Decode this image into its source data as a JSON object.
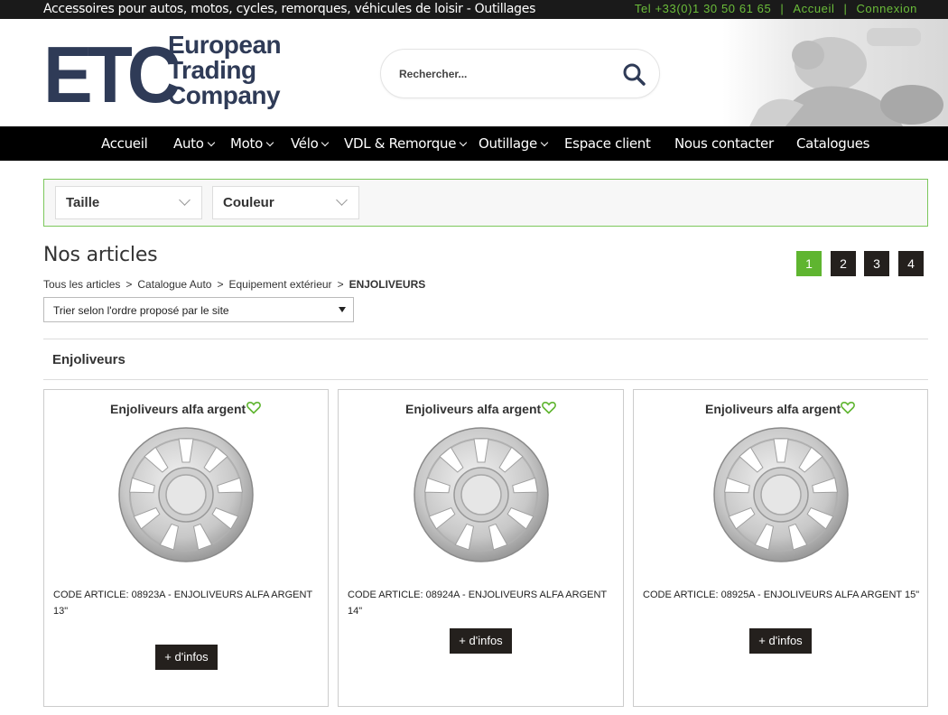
{
  "topbar": {
    "tagline": "Accessoires pour autos, motos, cycles, remorques, véhicules de loisir - Outillages",
    "phone": "Tel +33(0)1 30 50 61 65",
    "separator": "|",
    "home_link": "Accueil",
    "login_link": "Connexion"
  },
  "header": {
    "logo_letters": "ETC",
    "logo_words": [
      "European",
      "Trading",
      "Company"
    ],
    "search_placeholder": "Rechercher...",
    "search_icon": "search-icon"
  },
  "nav": {
    "items": [
      {
        "label": "Accueil",
        "dropdown": false
      },
      {
        "label": "Auto",
        "dropdown": true
      },
      {
        "label": "Moto",
        "dropdown": true
      },
      {
        "label": "Vélo",
        "dropdown": true
      },
      {
        "label": "VDL & Remorque",
        "dropdown": true
      },
      {
        "label": "Outillage",
        "dropdown": true
      },
      {
        "label": "Espace client",
        "dropdown": false
      },
      {
        "label": "Nous contacter",
        "dropdown": false
      },
      {
        "label": "Catalogues",
        "dropdown": false
      }
    ]
  },
  "filters": {
    "size_label": "Taille",
    "color_label": "Couleur"
  },
  "main": {
    "title": "Nos articles",
    "pages": [
      "1",
      "2",
      "3",
      "4"
    ],
    "current_page": "1",
    "breadcrumb": {
      "items": [
        "Tous les articles",
        "Catalogue Auto",
        "Equipement extérieur"
      ],
      "current": "ENJOLIVEURS",
      "separator": ">"
    },
    "sort_label": "Trier selon l'ordre proposé par le site",
    "section_title": "Enjoliveurs"
  },
  "products": [
    {
      "name": "Enjoliveurs alfa argent",
      "code_line1": "CODE ARTICLE: 08923A - ENJOLIVEURS ALFA ARGENT",
      "code_line2": "13\"",
      "button": "+ d'infos"
    },
    {
      "name": "Enjoliveurs alfa argent",
      "code_line1": "CODE ARTICLE: 08924A - ENJOLIVEURS ALFA ARGENT 14\"",
      "code_line2": "",
      "button": "+ d'infos"
    },
    {
      "name": "Enjoliveurs alfa argent",
      "code_line1": "CODE ARTICLE: 08925A - ENJOLIVEURS ALFA ARGENT 15\"",
      "code_line2": "",
      "button": "+ d'infos"
    }
  ],
  "colors": {
    "accent_green": "#5fb530",
    "topbar_link": "#6bbd3a",
    "logo_navy": "#2f3b57",
    "dark_button": "#24201d"
  }
}
